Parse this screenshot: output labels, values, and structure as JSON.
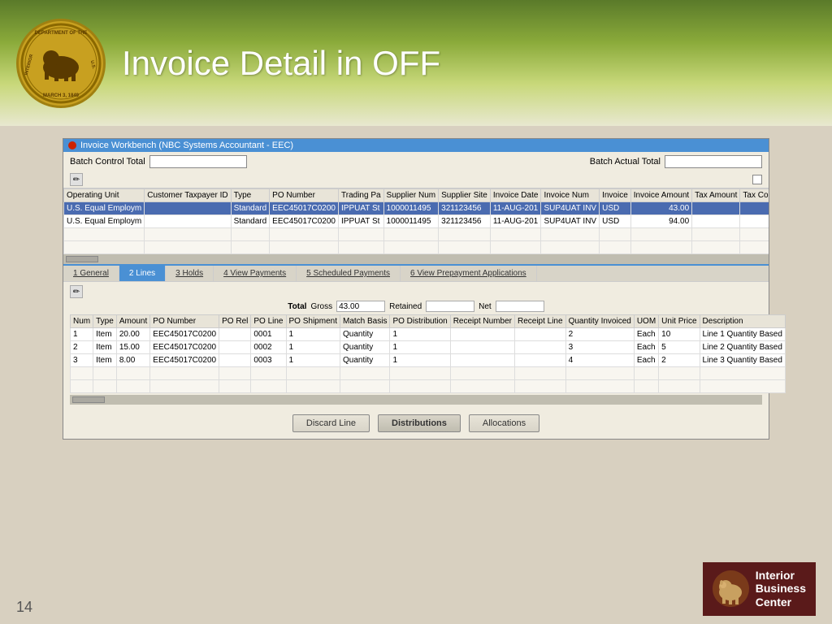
{
  "header": {
    "title": "Invoice Detail in OFF",
    "seal_label": "DEPT OF THE INTERIOR"
  },
  "window": {
    "title": "Invoice Workbench (NBC Systems Accountant - EEC)",
    "batch_control_total_label": "Batch Control Total",
    "batch_actual_total_label": "Batch Actual Total"
  },
  "invoice_table": {
    "columns": [
      "Operating Unit",
      "Customer Taxpayer ID",
      "Type",
      "PO Number",
      "Trading Pa",
      "Supplier Num",
      "Supplier Site",
      "Invoice Date",
      "Invoice Num",
      "Invoice",
      "Invoice Amount",
      "Tax Amount",
      "Tax Control Am"
    ],
    "rows": [
      {
        "operating_unit": "U.S. Equal Employm",
        "customer_taxpayer_id": "",
        "type": "Standard",
        "po_number": "EEC45017C0200",
        "trading_pa": "IPPUAT St",
        "supplier_num": "1000011495",
        "supplier_site": "321123456",
        "invoice_date": "11-AUG-201",
        "invoice_num": "SUP4UAT INV",
        "invoice": "USD",
        "invoice_amount": "43.00",
        "tax_amount": "",
        "tax_control_am": "",
        "selected": true
      },
      {
        "operating_unit": "U.S. Equal Employm",
        "customer_taxpayer_id": "",
        "type": "Standard",
        "po_number": "EEC45017C0200",
        "trading_pa": "IPPUAT St",
        "supplier_num": "1000011495",
        "supplier_site": "321123456",
        "invoice_date": "11-AUG-201",
        "invoice_num": "SUP4UAT INV",
        "invoice": "USD",
        "invoice_amount": "94.00",
        "tax_amount": "",
        "tax_control_am": "",
        "selected": false
      }
    ]
  },
  "tabs": [
    {
      "label": "1 General",
      "active": false
    },
    {
      "label": "2 Lines",
      "active": true
    },
    {
      "label": "3 Holds",
      "active": false
    },
    {
      "label": "4 View Payments",
      "active": false
    },
    {
      "label": "5 Scheduled Payments",
      "active": false
    },
    {
      "label": "6 View Prepayment Applications",
      "active": false
    }
  ],
  "totals": {
    "label": "Total",
    "gross_label": "Gross",
    "gross_value": "43.00",
    "retained_label": "Retained",
    "retained_value": "",
    "net_label": "Net",
    "net_value": ""
  },
  "lines_table": {
    "columns": [
      "Num",
      "Type",
      "Amount",
      "PO Number",
      "PO Rel",
      "PO Line",
      "PO Shipment",
      "Match Basis",
      "PO Distribution",
      "Receipt Number",
      "Receipt Line",
      "Quantity Invoiced",
      "UOM",
      "Unit Price",
      "Description"
    ],
    "rows": [
      {
        "num": "1",
        "type": "Item",
        "amount": "20.00",
        "po_number": "EEC45017C0200",
        "po_rel": "",
        "po_line": "0001",
        "po_shipment": "1",
        "match_basis": "Quantity",
        "po_distribution": "1",
        "receipt_number": "",
        "receipt_line": "",
        "quantity_invoiced": "2",
        "uom": "Each",
        "unit_price": "10",
        "description": "Line 1 Quantity Based"
      },
      {
        "num": "2",
        "type": "Item",
        "amount": "15.00",
        "po_number": "EEC45017C0200",
        "po_rel": "",
        "po_line": "0002",
        "po_shipment": "1",
        "match_basis": "Quantity",
        "po_distribution": "1",
        "receipt_number": "",
        "receipt_line": "",
        "quantity_invoiced": "3",
        "uom": "Each",
        "unit_price": "5",
        "description": "Line 2 Quantity Based"
      },
      {
        "num": "3",
        "type": "Item",
        "amount": "8.00",
        "po_number": "EEC45017C0200",
        "po_rel": "",
        "po_line": "0003",
        "po_shipment": "1",
        "match_basis": "Quantity",
        "po_distribution": "1",
        "receipt_number": "",
        "receipt_line": "",
        "quantity_invoiced": "4",
        "uom": "Each",
        "unit_price": "2",
        "description": "Line 3 Quantity Based"
      }
    ]
  },
  "buttons": {
    "discard_line": "Discard Line",
    "distributions": "Distributions",
    "allocations": "Allocations"
  },
  "footer": {
    "page_number": "14"
  },
  "ibc": {
    "line1": "Interior",
    "line2": "Business",
    "line3": "Center"
  }
}
